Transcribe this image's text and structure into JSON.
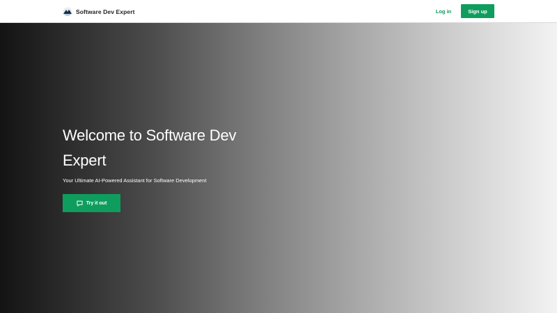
{
  "header": {
    "brand_name": "Software Dev Expert",
    "logo_icon": "mountain-globe-logo",
    "login_label": "Log in",
    "signup_label": "Sign up"
  },
  "hero": {
    "title": "Welcome to Software Dev Expert",
    "subtitle": "Your Ultimate AI-Powered Assistant for Software Development",
    "cta_label": "Try it out",
    "cta_icon": "chat-bubble-icon"
  },
  "colors": {
    "accent": "#0f9d5e",
    "gradient_start": "#131313",
    "gradient_end": "#f3f3f3"
  }
}
